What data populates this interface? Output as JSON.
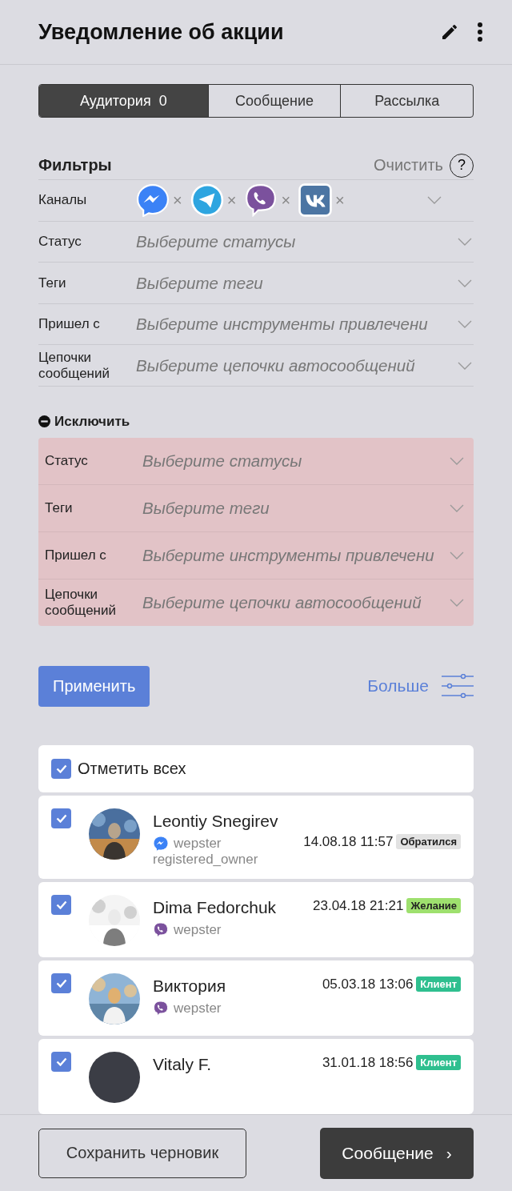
{
  "header": {
    "title": "Уведомление об акции"
  },
  "tabs": [
    {
      "label": "Аудитория",
      "count": "0",
      "selected": true
    },
    {
      "label": "Сообщение",
      "selected": false
    },
    {
      "label": "Рассылка",
      "selected": false
    }
  ],
  "filters": {
    "title": "Фильтры",
    "clear": "Очистить",
    "help": "?",
    "channels": {
      "label": "Каналы",
      "items": [
        {
          "kind": "messenger",
          "remove": "×"
        },
        {
          "kind": "telegram",
          "remove": "×"
        },
        {
          "kind": "viber",
          "remove": "×"
        },
        {
          "kind": "vk",
          "remove": "×"
        }
      ]
    },
    "rows": [
      {
        "label": "Статус",
        "placeholder": "Выберите статусы"
      },
      {
        "label": "Теги",
        "placeholder": "Выберите теги"
      },
      {
        "label": "Пришел с",
        "placeholder": "Выберите инструменты привлечени"
      },
      {
        "label": "Цепочки сообщений",
        "placeholder": "Выберите цепочки автосообщений"
      }
    ]
  },
  "exclude": {
    "title": "Исключить",
    "rows": [
      {
        "label": "Статус",
        "placeholder": "Выберите статусы"
      },
      {
        "label": "Теги",
        "placeholder": "Выберите теги"
      },
      {
        "label": "Пришел с",
        "placeholder": "Выберите инструменты привлечени"
      },
      {
        "label": "Цепочки сообщений",
        "placeholder": "Выберите цепочки автосообщений"
      }
    ]
  },
  "actions": {
    "apply": "Применить",
    "more": "Больше"
  },
  "select_all": {
    "label": "Отметить всех",
    "checked": true
  },
  "contacts": [
    {
      "name": "Leontiy Snegirev",
      "checked": true,
      "channel": {
        "kind": "messenger"
      },
      "account": "wepster",
      "extra": "registered_owner",
      "date": "14.08.18 11:57",
      "tag": {
        "label": "Обратился",
        "color": "#e2e2e2"
      }
    },
    {
      "name": "Dima Fedorchuk",
      "checked": true,
      "channel": {
        "kind": "viber"
      },
      "account": "wepster",
      "date": "23.04.18 21:21",
      "tag": {
        "label": "Желание",
        "color": "#9ee06e"
      }
    },
    {
      "name": "Виктория",
      "checked": true,
      "channel": {
        "kind": "viber"
      },
      "account": "wepster",
      "date": "05.03.18 13:06",
      "tag": {
        "label": "Клиент",
        "color": "#2fbf8f"
      }
    },
    {
      "name": "Vitaly F.",
      "checked": true,
      "avatar": {
        "kind": "initials"
      },
      "date": "31.01.18 18:56",
      "tag": {
        "label": "Клиент",
        "color": "#2fbf8f"
      }
    }
  ],
  "footer": {
    "draft": "Сохранить черновик",
    "next": "Сообщение",
    "next_icon": "›"
  }
}
